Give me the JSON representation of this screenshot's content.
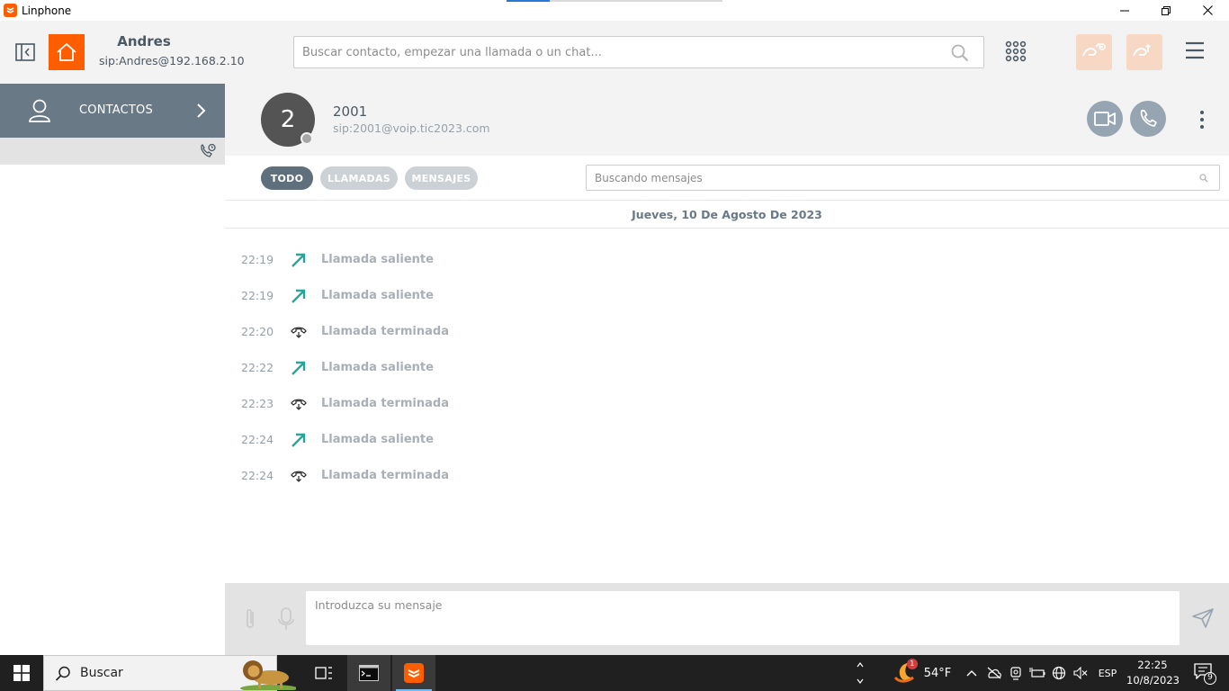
{
  "window": {
    "title": "Linphone",
    "minimize_glyph": "—",
    "restore_glyph": "❐",
    "close_glyph": "✕"
  },
  "account": {
    "name": "Andres",
    "address": "sip:Andres@192.168.2.10"
  },
  "search": {
    "placeholder": "Buscar contacto, empezar una llamada o un chat..."
  },
  "sidebar": {
    "contacts_label": "CONTACTOS"
  },
  "contact": {
    "avatar_initial": "2",
    "name": "2001",
    "sip": "sip:2001@voip.tic2023.com"
  },
  "filters": [
    {
      "label": "TODO",
      "active": true
    },
    {
      "label": "LLAMADAS",
      "active": false
    },
    {
      "label": "MENSAJES",
      "active": false
    }
  ],
  "message_search": {
    "placeholder": "Buscando mensajes"
  },
  "date_header": "Jueves, 10 De Agosto De 2023",
  "events": [
    {
      "time": "22:19",
      "type": "outgoing",
      "label": "Llamada saliente"
    },
    {
      "time": "22:19",
      "type": "outgoing",
      "label": "Llamada saliente"
    },
    {
      "time": "22:20",
      "type": "ended",
      "label": "Llamada terminada"
    },
    {
      "time": "22:22",
      "type": "outgoing",
      "label": "Llamada saliente"
    },
    {
      "time": "22:23",
      "type": "ended",
      "label": "Llamada terminada"
    },
    {
      "time": "22:24",
      "type": "outgoing",
      "label": "Llamada saliente"
    },
    {
      "time": "22:24",
      "type": "ended",
      "label": "Llamada terminada"
    }
  ],
  "composer": {
    "placeholder": "Introduzca su mensaje"
  },
  "taskbar": {
    "search_label": "Buscar",
    "weather_temp": "54°F",
    "weather_badge": "1",
    "language": "ESP",
    "time": "22:25",
    "date": "10/8/2023",
    "notifications_count": "9"
  },
  "colors": {
    "accent": "#fe5e00",
    "sidebar_active": "#6a7986",
    "outgoing_arrow": "#26a69a",
    "text_dark": "#4b5964"
  }
}
